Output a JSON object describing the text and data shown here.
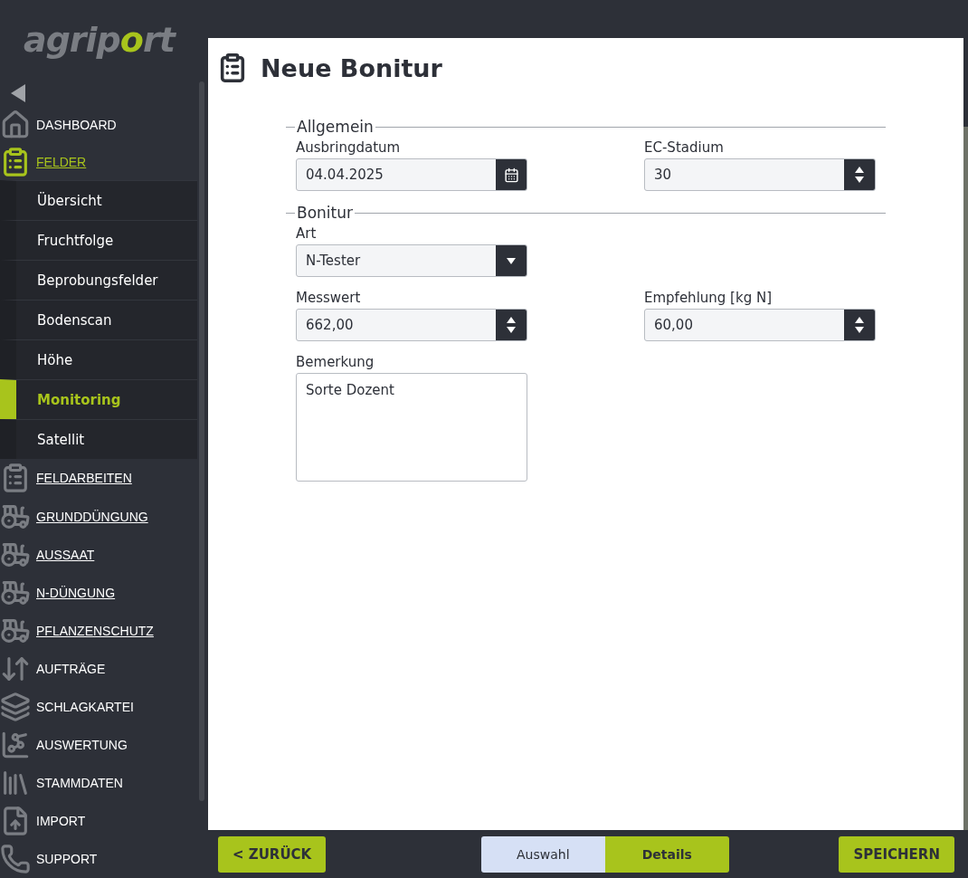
{
  "logo": {
    "text_left": "agrip",
    "text_mid": "o",
    "text_right": "rt"
  },
  "sidebar": {
    "items": [
      {
        "label": "DASHBOARD",
        "selected": false,
        "underlined": false
      },
      {
        "label": "FELDER",
        "selected": true,
        "underlined": true,
        "children": [
          {
            "label": "Übersicht",
            "selected": false
          },
          {
            "label": "Fruchtfolge",
            "selected": false
          },
          {
            "label": "Beprobungsfelder",
            "selected": false
          },
          {
            "label": "Bodenscan",
            "selected": false
          },
          {
            "label": "Höhe",
            "selected": false
          },
          {
            "label": "Monitoring",
            "selected": true
          },
          {
            "label": "Satellit",
            "selected": false
          }
        ]
      },
      {
        "label": "FELDARBEITEN",
        "selected": false,
        "underlined": true
      },
      {
        "label": "GRUNDDÜNGUNG",
        "selected": false,
        "underlined": true
      },
      {
        "label": "AUSSAAT",
        "selected": false,
        "underlined": true
      },
      {
        "label": "N-DÜNGUNG",
        "selected": false,
        "underlined": true
      },
      {
        "label": "PFLANZENSCHUTZ",
        "selected": false,
        "underlined": true
      },
      {
        "label": "AUFTRÄGE",
        "selected": false,
        "underlined": false
      },
      {
        "label": "SCHLAGKARTEI",
        "selected": false,
        "underlined": false
      },
      {
        "label": "AUSWERTUNG",
        "selected": false,
        "underlined": false
      },
      {
        "label": "STAMMDATEN",
        "selected": false,
        "underlined": false
      },
      {
        "label": "IMPORT",
        "selected": false,
        "underlined": false
      },
      {
        "label": "SUPPORT",
        "selected": false,
        "underlined": false
      }
    ]
  },
  "page": {
    "title": "Neue Bonitur"
  },
  "sections": [
    {
      "legend": "Allgemein",
      "fields": [
        {
          "label": "Ausbringdatum",
          "value": "04.04.2025",
          "kind": "date"
        },
        {
          "label": "EC-Stadium",
          "value": "30",
          "kind": "number"
        }
      ]
    },
    {
      "legend": "Bonitur",
      "fields": [
        {
          "label": "Art",
          "value": "N-Tester",
          "kind": "select"
        },
        {
          "kind": "empty"
        },
        {
          "label": "Messwert",
          "value": "662,00",
          "kind": "number"
        },
        {
          "label": "Empfehlung [kg N]",
          "value": "60,00",
          "kind": "number"
        },
        {
          "label": "Bemerkung",
          "value": "Sorte Dozent",
          "kind": "textarea"
        }
      ]
    }
  ],
  "footer": {
    "back": "< ZURÜCK",
    "steps": [
      {
        "label": "Auswahl",
        "selected": false
      },
      {
        "label": "Details",
        "selected": true
      }
    ],
    "save": "SPEICHERN"
  }
}
